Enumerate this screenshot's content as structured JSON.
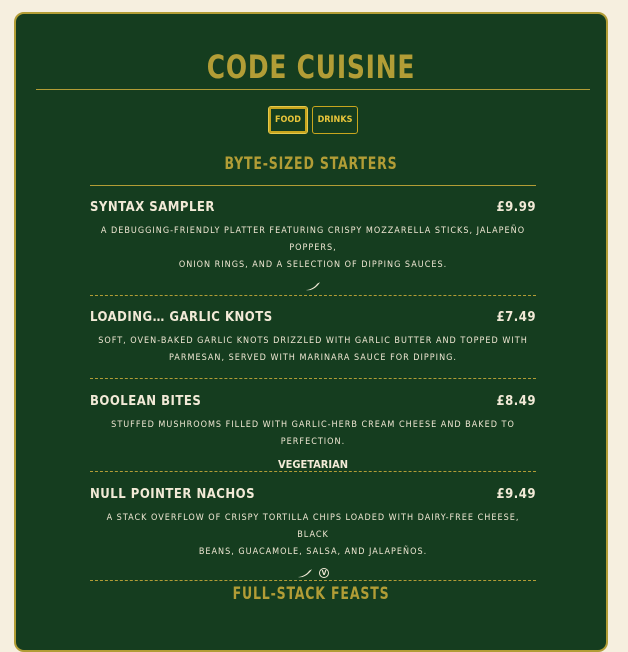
{
  "header": {
    "title": "CODE CUISINE"
  },
  "tabs": [
    {
      "label": "FOOD"
    },
    {
      "label": "DRINKS"
    }
  ],
  "sections": [
    {
      "title": "BYTE-SIZED STARTERS",
      "items": [
        {
          "name": "SYNTAX SAMPLER",
          "price": "£9.99",
          "desc_line1": "A DEBUGGING-FRIENDLY PLATTER FEATURING CRISPY MOZZARELLA STICKS, JALAPEÑO POPPERS,",
          "desc_line2": "ONION RINGS, AND A SELECTION OF DIPPING SAUCES.",
          "tag_icons": [
            "chili-icon"
          ]
        },
        {
          "name": "LOADING… GARLIC KNOTS",
          "price": "£7.49",
          "desc_line1": "SOFT, OVEN-BAKED GARLIC KNOTS DRIZZLED WITH GARLIC BUTTER AND TOPPED WITH",
          "desc_line2": "PARMESAN, SERVED WITH MARINARA SAUCE FOR DIPPING."
        },
        {
          "name": "BOOLEAN BITES",
          "price": "£8.49",
          "desc_line1": "STUFFED MUSHROOMS FILLED WITH GARLIC-HERB CREAM CHEESE AND BAKED TO PERFECTION.",
          "tag_text": "VEGETARIAN"
        },
        {
          "name": "NULL POINTER NACHOS",
          "price": "£9.49",
          "desc_line1": "A STACK OVERFLOW OF CRISPY TORTILLA CHIPS LOADED WITH DAIRY-FREE CHEESE, BLACK",
          "desc_line2": "BEANS, GUACAMOLE, SALSA, AND JALAPEÑOS.",
          "tag_icons": [
            "chili-icon",
            "vegan-icon"
          ],
          "vegan_mark": "V"
        }
      ]
    },
    {
      "title": "FULL-STACK FEASTS"
    }
  ],
  "colors": {
    "background": "#f6efdf",
    "card": "#153d1f",
    "accent": "#b29d36",
    "text": "#f2ead7",
    "tab": "#e8c53a"
  }
}
